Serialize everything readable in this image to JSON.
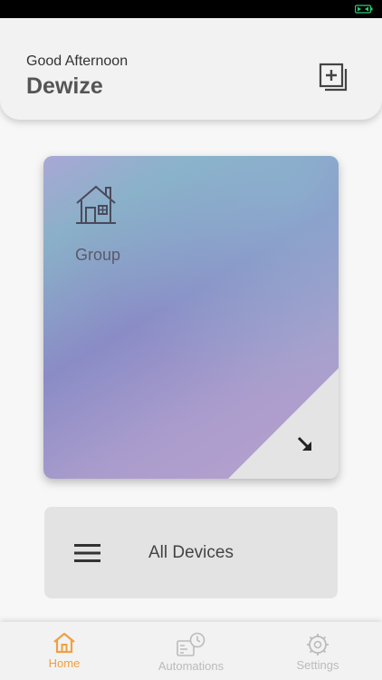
{
  "header": {
    "greeting": "Good Afternoon",
    "user_name": "Dewize"
  },
  "icons": {
    "add": "add-group-icon",
    "house": "house-icon",
    "arrow": "arrow-down-right-icon",
    "menu": "hamburger-menu-icon",
    "home": "home-icon",
    "automations": "automations-icon",
    "settings": "settings-icon",
    "battery": "battery-icon"
  },
  "group_card": {
    "label": "Group"
  },
  "all_devices": {
    "label": "All Devices"
  },
  "nav": {
    "home": "Home",
    "automations": "Automations",
    "settings": "Settings"
  },
  "colors": {
    "accent": "#f0a040",
    "battery": "#2ecc71",
    "inactive": "#bbbbbb"
  }
}
